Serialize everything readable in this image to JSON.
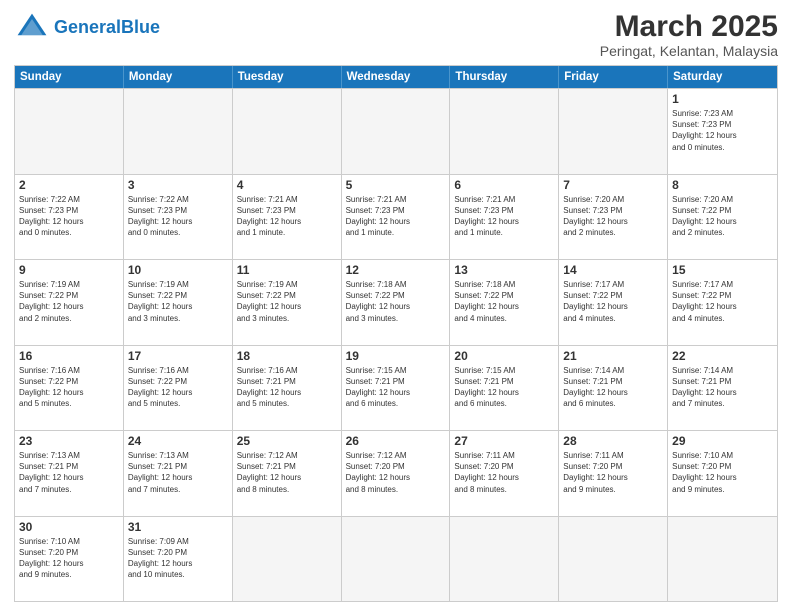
{
  "header": {
    "logo_general": "General",
    "logo_blue": "Blue",
    "month_title": "March 2025",
    "subtitle": "Peringat, Kelantan, Malaysia"
  },
  "days_of_week": [
    "Sunday",
    "Monday",
    "Tuesday",
    "Wednesday",
    "Thursday",
    "Friday",
    "Saturday"
  ],
  "weeks": [
    [
      {
        "day": "",
        "info": ""
      },
      {
        "day": "",
        "info": ""
      },
      {
        "day": "",
        "info": ""
      },
      {
        "day": "",
        "info": ""
      },
      {
        "day": "",
        "info": ""
      },
      {
        "day": "",
        "info": ""
      },
      {
        "day": "1",
        "info": "Sunrise: 7:23 AM\nSunset: 7:23 PM\nDaylight: 12 hours\nand 0 minutes."
      }
    ],
    [
      {
        "day": "2",
        "info": "Sunrise: 7:22 AM\nSunset: 7:23 PM\nDaylight: 12 hours\nand 0 minutes."
      },
      {
        "day": "3",
        "info": "Sunrise: 7:22 AM\nSunset: 7:23 PM\nDaylight: 12 hours\nand 0 minutes."
      },
      {
        "day": "4",
        "info": "Sunrise: 7:21 AM\nSunset: 7:23 PM\nDaylight: 12 hours\nand 1 minute."
      },
      {
        "day": "5",
        "info": "Sunrise: 7:21 AM\nSunset: 7:23 PM\nDaylight: 12 hours\nand 1 minute."
      },
      {
        "day": "6",
        "info": "Sunrise: 7:21 AM\nSunset: 7:23 PM\nDaylight: 12 hours\nand 1 minute."
      },
      {
        "day": "7",
        "info": "Sunrise: 7:20 AM\nSunset: 7:23 PM\nDaylight: 12 hours\nand 2 minutes."
      },
      {
        "day": "8",
        "info": "Sunrise: 7:20 AM\nSunset: 7:22 PM\nDaylight: 12 hours\nand 2 minutes."
      }
    ],
    [
      {
        "day": "9",
        "info": "Sunrise: 7:19 AM\nSunset: 7:22 PM\nDaylight: 12 hours\nand 2 minutes."
      },
      {
        "day": "10",
        "info": "Sunrise: 7:19 AM\nSunset: 7:22 PM\nDaylight: 12 hours\nand 3 minutes."
      },
      {
        "day": "11",
        "info": "Sunrise: 7:19 AM\nSunset: 7:22 PM\nDaylight: 12 hours\nand 3 minutes."
      },
      {
        "day": "12",
        "info": "Sunrise: 7:18 AM\nSunset: 7:22 PM\nDaylight: 12 hours\nand 3 minutes."
      },
      {
        "day": "13",
        "info": "Sunrise: 7:18 AM\nSunset: 7:22 PM\nDaylight: 12 hours\nand 4 minutes."
      },
      {
        "day": "14",
        "info": "Sunrise: 7:17 AM\nSunset: 7:22 PM\nDaylight: 12 hours\nand 4 minutes."
      },
      {
        "day": "15",
        "info": "Sunrise: 7:17 AM\nSunset: 7:22 PM\nDaylight: 12 hours\nand 4 minutes."
      }
    ],
    [
      {
        "day": "16",
        "info": "Sunrise: 7:16 AM\nSunset: 7:22 PM\nDaylight: 12 hours\nand 5 minutes."
      },
      {
        "day": "17",
        "info": "Sunrise: 7:16 AM\nSunset: 7:22 PM\nDaylight: 12 hours\nand 5 minutes."
      },
      {
        "day": "18",
        "info": "Sunrise: 7:16 AM\nSunset: 7:21 PM\nDaylight: 12 hours\nand 5 minutes."
      },
      {
        "day": "19",
        "info": "Sunrise: 7:15 AM\nSunset: 7:21 PM\nDaylight: 12 hours\nand 6 minutes."
      },
      {
        "day": "20",
        "info": "Sunrise: 7:15 AM\nSunset: 7:21 PM\nDaylight: 12 hours\nand 6 minutes."
      },
      {
        "day": "21",
        "info": "Sunrise: 7:14 AM\nSunset: 7:21 PM\nDaylight: 12 hours\nand 6 minutes."
      },
      {
        "day": "22",
        "info": "Sunrise: 7:14 AM\nSunset: 7:21 PM\nDaylight: 12 hours\nand 7 minutes."
      }
    ],
    [
      {
        "day": "23",
        "info": "Sunrise: 7:13 AM\nSunset: 7:21 PM\nDaylight: 12 hours\nand 7 minutes."
      },
      {
        "day": "24",
        "info": "Sunrise: 7:13 AM\nSunset: 7:21 PM\nDaylight: 12 hours\nand 7 minutes."
      },
      {
        "day": "25",
        "info": "Sunrise: 7:12 AM\nSunset: 7:21 PM\nDaylight: 12 hours\nand 8 minutes."
      },
      {
        "day": "26",
        "info": "Sunrise: 7:12 AM\nSunset: 7:20 PM\nDaylight: 12 hours\nand 8 minutes."
      },
      {
        "day": "27",
        "info": "Sunrise: 7:11 AM\nSunset: 7:20 PM\nDaylight: 12 hours\nand 8 minutes."
      },
      {
        "day": "28",
        "info": "Sunrise: 7:11 AM\nSunset: 7:20 PM\nDaylight: 12 hours\nand 9 minutes."
      },
      {
        "day": "29",
        "info": "Sunrise: 7:10 AM\nSunset: 7:20 PM\nDaylight: 12 hours\nand 9 minutes."
      }
    ],
    [
      {
        "day": "30",
        "info": "Sunrise: 7:10 AM\nSunset: 7:20 PM\nDaylight: 12 hours\nand 9 minutes."
      },
      {
        "day": "31",
        "info": "Sunrise: 7:09 AM\nSunset: 7:20 PM\nDaylight: 12 hours\nand 10 minutes."
      },
      {
        "day": "",
        "info": ""
      },
      {
        "day": "",
        "info": ""
      },
      {
        "day": "",
        "info": ""
      },
      {
        "day": "",
        "info": ""
      },
      {
        "day": "",
        "info": ""
      }
    ]
  ]
}
